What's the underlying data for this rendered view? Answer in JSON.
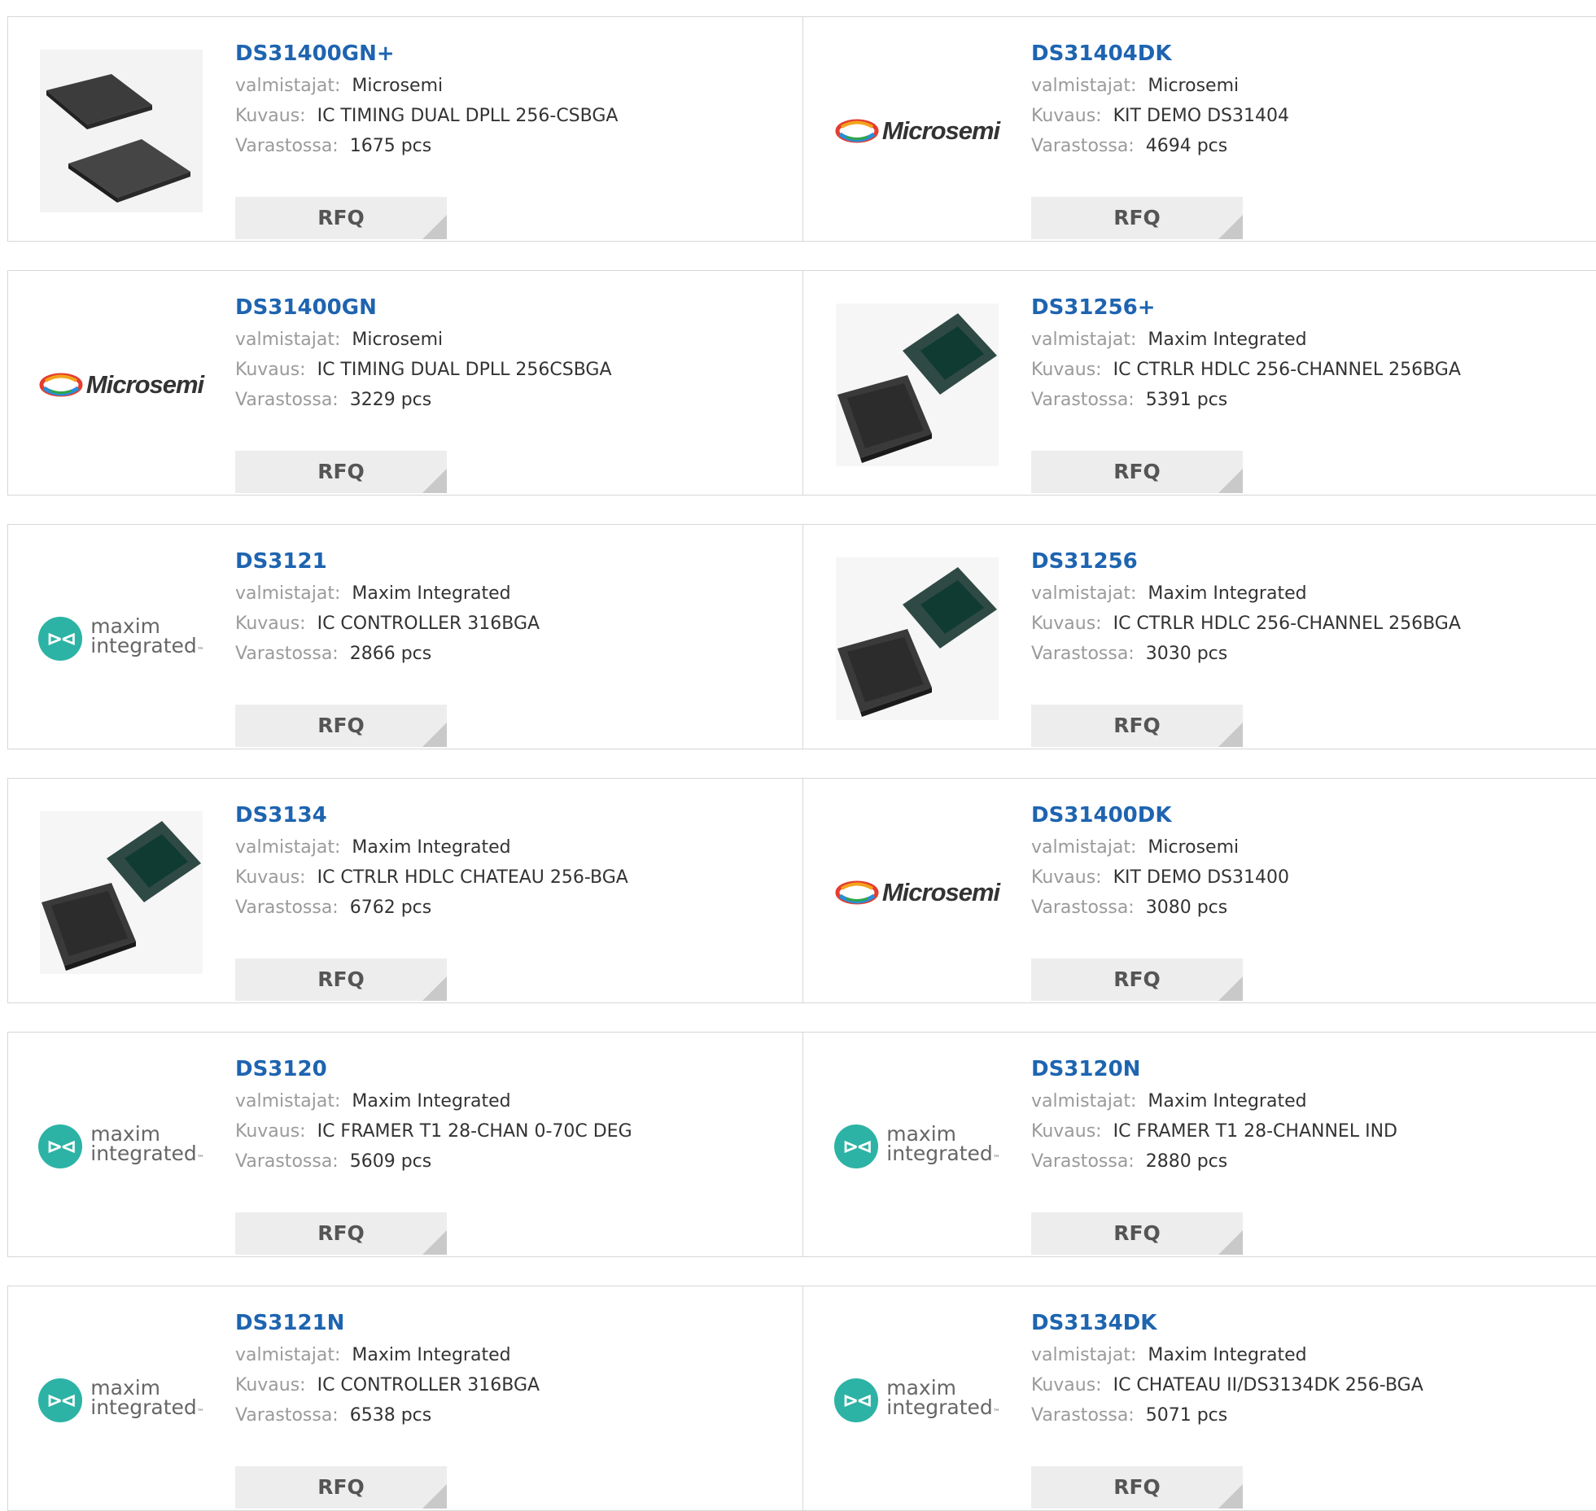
{
  "labels": {
    "manufacturer": "valmistajat:",
    "description": "Kuvaus:",
    "stock": "Varastossa:",
    "rfq": "RFQ"
  },
  "logos": {
    "microsemi": "Microsemi",
    "maxim_line1": "maxim",
    "maxim_line2": "integrated",
    "maxim_tm": "™"
  },
  "products": [
    {
      "name": "DS31400GN+",
      "manufacturer": "Microsemi",
      "description": "IC TIMING DUAL DPLL 256-CSBGA",
      "stock": "1675 pcs",
      "image": "bga-chip-flat-icon"
    },
    {
      "name": "DS31404DK",
      "manufacturer": "Microsemi",
      "description": "KIT DEMO DS31404",
      "stock": "4694 pcs",
      "image": "microsemi-logo"
    },
    {
      "name": "DS31400GN",
      "manufacturer": "Microsemi",
      "description": "IC TIMING DUAL DPLL 256CSBGA",
      "stock": "3229 pcs",
      "image": "microsemi-logo"
    },
    {
      "name": "DS31256+",
      "manufacturer": "Maxim Integrated",
      "description": "IC CTRLR HDLC 256-CHANNEL 256BGA",
      "stock": "5391 pcs",
      "image": "bga-chip-pair-icon"
    },
    {
      "name": "DS3121",
      "manufacturer": "Maxim Integrated",
      "description": "IC CONTROLLER 316BGA",
      "stock": "2866 pcs",
      "image": "maxim-logo"
    },
    {
      "name": "DS31256",
      "manufacturer": "Maxim Integrated",
      "description": "IC CTRLR HDLC 256-CHANNEL 256BGA",
      "stock": "3030 pcs",
      "image": "bga-chip-pair-icon"
    },
    {
      "name": "DS3134",
      "manufacturer": "Maxim Integrated",
      "description": "IC CTRLR HDLC CHATEAU 256-BGA",
      "stock": "6762 pcs",
      "image": "bga-chip-pair-icon"
    },
    {
      "name": "DS31400DK",
      "manufacturer": "Microsemi",
      "description": "KIT DEMO DS31400",
      "stock": "3080 pcs",
      "image": "microsemi-logo"
    },
    {
      "name": "DS3120",
      "manufacturer": "Maxim Integrated",
      "description": "IC FRAMER T1 28-CHAN 0-70C DEG",
      "stock": "5609 pcs",
      "image": "maxim-logo"
    },
    {
      "name": "DS3120N",
      "manufacturer": "Maxim Integrated",
      "description": "IC FRAMER T1 28-CHANNEL IND",
      "stock": "2880 pcs",
      "image": "maxim-logo"
    },
    {
      "name": "DS3121N",
      "manufacturer": "Maxim Integrated",
      "description": "IC CONTROLLER 316BGA",
      "stock": "6538 pcs",
      "image": "maxim-logo"
    },
    {
      "name": "DS3134DK",
      "manufacturer": "Maxim Integrated",
      "description": "IC CHATEAU II/DS3134DK 256-BGA",
      "stock": "5071 pcs",
      "image": "maxim-logo"
    }
  ]
}
